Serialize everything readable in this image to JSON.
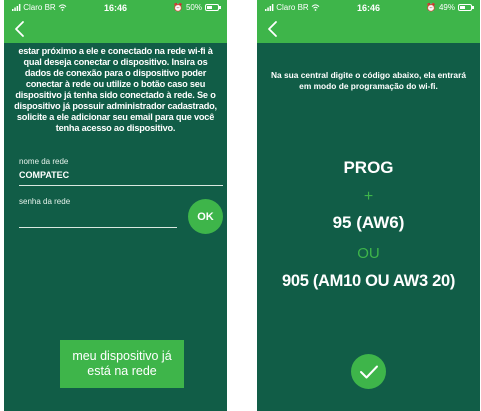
{
  "left_screen": {
    "status": {
      "carrier": "Claro BR",
      "time": "16:46",
      "battery": "50%",
      "battery_level": 0.5
    },
    "intro_text": "estar próximo a ele e conectado na rede wi-fi à qual deseja conectar o dispositivo. Insira os dados de conexão para o dispositivo poder conectar à rede ou utilize o botão caso seu dispositivo já tenha sido conectado à rede. Se o dispositivo já possuir administrador cadastrado, solicite a ele adicionar seu email para que você tenha acesso ao dispositivo.",
    "network_name_label": "nome da rede",
    "network_name_value": "COMPATEC",
    "password_label": "senha da rede",
    "password_value": "",
    "ok_label": "OK",
    "device_button_label": "meu dispositivo já está na rede"
  },
  "right_screen": {
    "status": {
      "carrier": "Claro BR",
      "time": "16:46",
      "battery": "49%",
      "battery_level": 0.49
    },
    "intro_text": "Na sua central digite o código abaixo, ela entrará em modo de programação do wi-fi.",
    "code_lines": [
      "PROG",
      "+",
      "95 (AW6)",
      "OU",
      "905 (AM10 OU AW3 20)"
    ]
  },
  "colors": {
    "background": "#115d47",
    "accent": "#3eb54a",
    "text": "#ffffff"
  },
  "icons": {
    "back": "chevron-left-icon",
    "confirm": "checkmark-icon",
    "signal": "signal-bars-icon",
    "wifi": "wifi-icon",
    "battery": "battery-icon"
  }
}
